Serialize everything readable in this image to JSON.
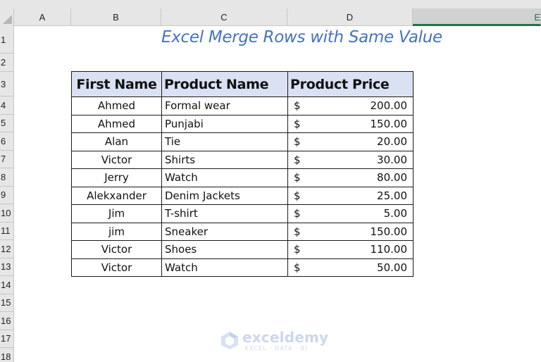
{
  "sheet": {
    "columns": [
      "A",
      "B",
      "C",
      "D",
      "E"
    ],
    "selected_column": "E",
    "rows": [
      "1",
      "2",
      "3",
      "4",
      "5",
      "6",
      "7",
      "8",
      "9",
      "10",
      "11",
      "12",
      "13",
      "14",
      "15",
      "16",
      "17",
      "18"
    ]
  },
  "title": "Excel Merge Rows with Same Value",
  "table": {
    "headers": [
      "First Name",
      "Product Name",
      "Product Price"
    ],
    "currency_symbol": "$",
    "rows": [
      {
        "first_name": "Ahmed",
        "product": "Formal wear",
        "price": "200.00"
      },
      {
        "first_name": "Ahmed",
        "product": "Punjabi",
        "price": "150.00"
      },
      {
        "first_name": "Alan",
        "product": "Tie",
        "price": "20.00"
      },
      {
        "first_name": "Victor",
        "product": "Shirts",
        "price": "30.00"
      },
      {
        "first_name": "Jerry",
        "product": "Watch",
        "price": "80.00"
      },
      {
        "first_name": "Alekxander",
        "product": "Denim Jackets",
        "price": "25.00"
      },
      {
        "first_name": "Jim",
        "product": "T-shirt",
        "price": "5.00"
      },
      {
        "first_name": "jim",
        "product": "Sneaker",
        "price": "150.00"
      },
      {
        "first_name": "Victor",
        "product": "Shoes",
        "price": "110.00"
      },
      {
        "first_name": "Victor",
        "product": "Watch",
        "price": "50.00"
      }
    ]
  },
  "watermark": {
    "name": "exceldemy",
    "tagline": "EXCEL · DATA · BI"
  },
  "colors": {
    "title": "#4472c4",
    "header_fill": "#d9e1f2",
    "selection_accent": "#217346"
  }
}
